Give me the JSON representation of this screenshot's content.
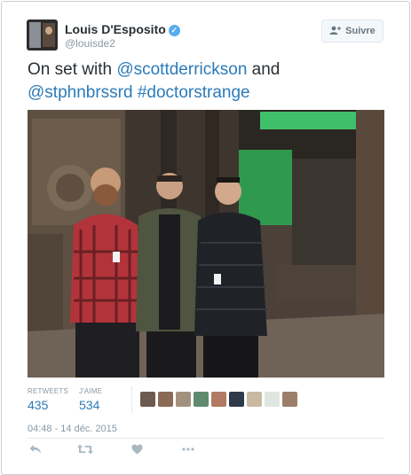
{
  "tweet": {
    "author_name": "Louis D'Esposito",
    "handle": "@louisde2",
    "follow_label": "Suivre",
    "text_prefix": "On set with ",
    "mention_1": "@scottderrickson",
    "text_middle": " and",
    "mention_2": "@stphnbrssrd",
    "hashtag": "#doctorstrange",
    "retweets_label": "RETWEETS",
    "retweets_count": "435",
    "likes_label": "J'AIME",
    "likes_count": "534",
    "timestamp": "04:48 - 14 déc. 2015"
  },
  "likers": [
    "#6d5a4e",
    "#8a6a56",
    "#a3917f",
    "#5e8a6e",
    "#b07a63",
    "#2e3a4a",
    "#c9b8a2",
    "#dfe6e0",
    "#9c7f6a"
  ],
  "icons": {
    "verified": "verified-check-icon",
    "follow": "add-user-icon",
    "reply": "reply-icon",
    "retweet": "retweet-icon",
    "like": "heart-icon",
    "more": "more-icon"
  },
  "colors": {
    "link": "#2b7bb9",
    "verified": "#55acee",
    "muted": "#8899a6"
  }
}
